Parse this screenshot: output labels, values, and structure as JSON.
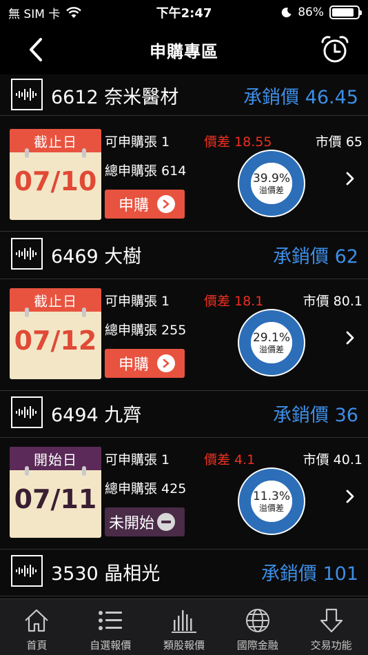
{
  "status_bar": {
    "carrier": "無 SIM 卡",
    "time": "下午2:47",
    "battery": "86%",
    "battery_level": 0.86
  },
  "header": {
    "title": "申購專區"
  },
  "items": [
    {
      "code_name": "6612 奈米醫材",
      "price_label": "承銷價 46.45",
      "date_label": "截止日",
      "date": "07/10",
      "available": "可申購張 1",
      "total": "總申購張 614",
      "diff": "價差 18.55",
      "market": "市價 65",
      "premium_pct": "39.9%",
      "premium_fraction": 0.399,
      "premium_label": "溢價差",
      "action_label": "申購",
      "state": "open"
    },
    {
      "code_name": "6469 大樹",
      "price_label": "承銷價 62",
      "date_label": "截止日",
      "date": "07/12",
      "available": "可申購張 1",
      "total": "總申購張 255",
      "diff": "價差 18.1",
      "market": "市價 80.1",
      "premium_pct": "29.1%",
      "premium_fraction": 0.291,
      "premium_label": "溢價差",
      "action_label": "申購",
      "state": "open"
    },
    {
      "code_name": "6494 九齊",
      "price_label": "承銷價 36",
      "date_label": "開始日",
      "date": "07/11",
      "available": "可申購張 1",
      "total": "總申購張 425",
      "diff": "價差 4.1",
      "market": "市價 40.1",
      "premium_pct": "11.3%",
      "premium_fraction": 0.113,
      "premium_label": "溢價差",
      "action_label": "未開始",
      "state": "not-started"
    },
    {
      "code_name": "3530 晶相光",
      "price_label": "承銷價 101"
    }
  ],
  "tabbar": {
    "tabs": [
      {
        "label": "首頁",
        "icon": "home-icon"
      },
      {
        "label": "自選報價",
        "icon": "list-icon"
      },
      {
        "label": "類股報價",
        "icon": "bar-chart-icon"
      },
      {
        "label": "國際金融",
        "icon": "globe-icon"
      },
      {
        "label": "交易功能",
        "icon": "download-arrow-icon"
      }
    ]
  },
  "colors": {
    "accent_blue": "#3d8ee6",
    "diff_red": "#ef2e1f",
    "calendar_red": "#e8533f",
    "calendar_purple": "#5b2a58",
    "donut_blue": "#2d6eb8",
    "donut_red": "#ff2a1a"
  }
}
